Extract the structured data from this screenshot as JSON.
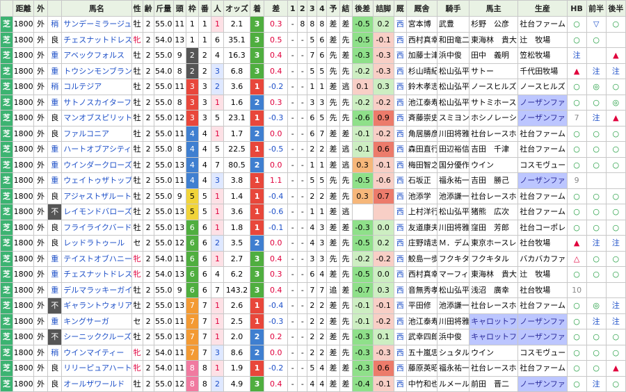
{
  "headers": [
    "距離",
    "外",
    "",
    "馬名",
    "性",
    "齢",
    "斤量",
    "頭",
    "枠",
    "番",
    "人",
    "オッズ",
    "着",
    "差",
    "1",
    "2",
    "3",
    "4",
    "予",
    "結",
    "後差",
    "詰脚",
    "厩",
    "厩舎",
    "騎手",
    "馬主",
    "生産",
    "HB",
    "前半",
    "後半"
  ],
  "surface": "芝",
  "rows": [
    {
      "dist": "1800",
      "io": "外",
      "cond": "稍",
      "name": "サンデーミラージュ",
      "sex": "牡",
      "age": "2",
      "wt": "55.0",
      "n": "11",
      "waku": "1",
      "ban": "1",
      "pop": "1",
      "odds": "2.1",
      "res": "3",
      "diff": "0.3",
      "c1": "-",
      "c2": "8",
      "c3": "8",
      "c4": "8",
      "yo": "差",
      "ke": "差",
      "ato": "-0.5",
      "tsume": "0.2",
      "umaya": "西",
      "kyu": "宮本博",
      "jockey": "武豊",
      "owner": "杉野　公彦",
      "maker": "社台ファーム",
      "hb": "○",
      "zen": "▽",
      "kou": "○"
    },
    {
      "dist": "1800",
      "io": "外",
      "cond": "良",
      "name": "チェスナットドレス",
      "sex": "牝",
      "age": "2",
      "wt": "54.0",
      "n": "13",
      "waku": "1",
      "ban": "1",
      "pop": "6",
      "odds": "35.1",
      "res": "3",
      "diff": "0.5",
      "c1": "-",
      "c2": "-",
      "c3": "5",
      "c4": "6",
      "yo": "差",
      "ke": "先",
      "ato": "-0.5",
      "tsume": "-0.1",
      "umaya": "西",
      "kyu": "西村真幸",
      "jockey": "和田竜二",
      "owner": "東海林　貴大",
      "maker": "辻　牧場",
      "hb": "○",
      "zen": "○",
      "kou": ""
    },
    {
      "dist": "1800",
      "io": "外",
      "cond": "重",
      "name": "アベックフォルス",
      "sex": "牡",
      "age": "2",
      "wt": "55.0",
      "n": "9",
      "waku": "2",
      "ban": "2",
      "pop": "4",
      "odds": "16.3",
      "res": "3",
      "diff": "0.4",
      "c1": "-",
      "c2": "-",
      "c3": "7",
      "c4": "6",
      "yo": "先",
      "ke": "差",
      "ato": "-0.3",
      "tsume": "-0.3",
      "umaya": "西",
      "kyu": "加藤士津",
      "jockey": "浜中俊",
      "owner": "田中　義明",
      "maker": "笠松牧場",
      "hb": "注",
      "zen": "",
      "kou": "▲"
    },
    {
      "dist": "1800",
      "io": "外",
      "cond": "重",
      "name": "トウシンモンブラン",
      "sex": "牡",
      "age": "2",
      "wt": "54.0",
      "n": "8",
      "waku": "2",
      "ban": "2",
      "pop": "3",
      "odds": "6.8",
      "res": "3",
      "diff": "0.4",
      "c1": "-",
      "c2": "-",
      "c3": "5",
      "c4": "5",
      "yo": "先",
      "ke": "先",
      "ato": "-0.2",
      "tsume": "-0.3",
      "umaya": "西",
      "kyu": "杉山晴紀",
      "jockey": "松山弘平",
      "owner": "サトー",
      "maker": "千代田牧場",
      "hb": "▲",
      "zen": "注",
      "kou": "注"
    },
    {
      "dist": "1800",
      "io": "外",
      "cond": "稍",
      "name": "コルテジア",
      "sex": "牡",
      "age": "2",
      "wt": "55.0",
      "n": "11",
      "waku": "3",
      "ban": "3",
      "pop": "2",
      "odds": "3.6",
      "res": "1",
      "diff": "-0.2",
      "c1": "-",
      "c2": "-",
      "c3": "1",
      "c4": "1",
      "yo": "差",
      "ke": "逃",
      "ato": "0.1",
      "tsume": "0.3",
      "umaya": "西",
      "kyu": "鈴木孝志",
      "jockey": "松山弘平",
      "owner": "ノースヒルズ",
      "maker": "ノースヒルズ",
      "hb": "○",
      "zen": "◎",
      "kou": "○"
    },
    {
      "dist": "1800",
      "io": "外",
      "cond": "重",
      "name": "サトノスカイターフ",
      "sex": "牡",
      "age": "2",
      "wt": "55.0",
      "n": "8",
      "waku": "3",
      "ban": "3",
      "pop": "1",
      "odds": "1.6",
      "res": "2",
      "diff": "0.3",
      "c1": "-",
      "c2": "-",
      "c3": "3",
      "c4": "3",
      "yo": "先",
      "ke": "先",
      "ato": "-0.2",
      "tsume": "-0.2",
      "umaya": "西",
      "kyu": "池江泰寿",
      "jockey": "松山弘平",
      "owner": "サトミホース",
      "maker": "ノーザンファ",
      "hb": "○",
      "zen": "○",
      "kou": "◎"
    },
    {
      "dist": "1800",
      "io": "外",
      "cond": "良",
      "name": "マンオブスピリット",
      "sex": "牡",
      "age": "2",
      "wt": "55.0",
      "n": "12",
      "waku": "3",
      "ban": "3",
      "pop": "5",
      "odds": "23.1",
      "res": "1",
      "diff": "-0.3",
      "c1": "-",
      "c2": "-",
      "c3": "6",
      "c4": "5",
      "yo": "先",
      "ke": "先",
      "ato": "-0.6",
      "tsume": "0.9",
      "umaya": "西",
      "kyu": "斉藤崇史",
      "jockey": "スミヨン",
      "owner": "ホシノレーシ",
      "maker": "ノーザンファ",
      "hb": "7",
      "zen": "注",
      "kou": "▲"
    },
    {
      "dist": "1800",
      "io": "外",
      "cond": "良",
      "name": "ファルコニア",
      "sex": "牡",
      "age": "2",
      "wt": "55.0",
      "n": "11",
      "waku": "4",
      "ban": "4",
      "pop": "1",
      "odds": "1.7",
      "res": "2",
      "diff": "0.0",
      "c1": "-",
      "c2": "-",
      "c3": "6",
      "c4": "7",
      "yo": "差",
      "ke": "差",
      "ato": "-0.1",
      "tsume": "-0.2",
      "umaya": "西",
      "kyu": "角居勝彦",
      "jockey": "川田将雅",
      "owner": "社台レースホ",
      "maker": "社台ファーム",
      "hb": "○",
      "zen": "○",
      "kou": "○"
    },
    {
      "dist": "1800",
      "io": "外",
      "cond": "重",
      "name": "ハートオブアシティ",
      "sex": "牡",
      "age": "2",
      "wt": "55.0",
      "n": "8",
      "waku": "4",
      "ban": "4",
      "pop": "5",
      "odds": "22.5",
      "res": "1",
      "diff": "-0.5",
      "c1": "-",
      "c2": "-",
      "c3": "2",
      "c4": "2",
      "yo": "差",
      "ke": "逃",
      "ato": "-0.1",
      "tsume": "0.6",
      "umaya": "西",
      "kyu": "森田直行",
      "jockey": "田辺裕信",
      "owner": "吉田　千津",
      "maker": "社台ファーム",
      "hb": "○",
      "zen": "○",
      "kou": "○"
    },
    {
      "dist": "1800",
      "io": "外",
      "cond": "重",
      "name": "ウインダークローズ",
      "sex": "牡",
      "age": "2",
      "wt": "55.0",
      "n": "13",
      "waku": "4",
      "ban": "4",
      "pop": "7",
      "odds": "80.5",
      "res": "2",
      "diff": "0.0",
      "c1": "-",
      "c2": "-",
      "c3": "1",
      "c4": "1",
      "yo": "差",
      "ke": "逃",
      "ato": "0.3",
      "tsume": "-0.1",
      "umaya": "西",
      "kyu": "梅田智之",
      "jockey": "国分優作",
      "owner": "ウイン",
      "maker": "コスモヴュー",
      "hb": "○",
      "zen": "○",
      "kou": "○"
    },
    {
      "dist": "1800",
      "io": "外",
      "cond": "重",
      "name": "ウェイトゥザトップ",
      "sex": "牡",
      "age": "2",
      "wt": "55.0",
      "n": "11",
      "waku": "4",
      "ban": "4",
      "pop": "3",
      "odds": "3.8",
      "res": "1",
      "diff": "1.1",
      "c1": "-",
      "c2": "-",
      "c3": "5",
      "c4": "5",
      "yo": "先",
      "ke": "先",
      "ato": "-0.5",
      "tsume": "-0.6",
      "umaya": "西",
      "kyu": "石坂正",
      "jockey": "福永祐一",
      "owner": "吉田　勝己",
      "maker": "ノーザンファ",
      "hb": "9",
      "zen": "",
      "kou": ""
    },
    {
      "dist": "1800",
      "io": "外",
      "cond": "良",
      "name": "アジャストザルート",
      "sex": "牡",
      "age": "2",
      "wt": "55.0",
      "n": "9",
      "waku": "5",
      "ban": "5",
      "pop": "1",
      "odds": "1.4",
      "res": "1",
      "diff": "-0.4",
      "c1": "-",
      "c2": "-",
      "c3": "2",
      "c4": "2",
      "yo": "差",
      "ke": "先",
      "ato": "0.3",
      "tsume": "0.7",
      "umaya": "西",
      "kyu": "池添学",
      "jockey": "池添謙一",
      "owner": "社台レースホ",
      "maker": "社台ファーム",
      "hb": "○",
      "zen": "○",
      "kou": "○"
    },
    {
      "dist": "1800",
      "io": "外",
      "cond": "不",
      "name": "レイモンドバローズ",
      "sex": "牡",
      "age": "2",
      "wt": "55.0",
      "n": "13",
      "waku": "5",
      "ban": "5",
      "pop": "1",
      "odds": "3.6",
      "res": "1",
      "diff": "-0.6",
      "c1": "-",
      "c2": "-",
      "c3": "1",
      "c4": "1",
      "yo": "差",
      "ke": "逃",
      "ato": "",
      "tsume": "",
      "umaya": "西",
      "kyu": "上村洋行",
      "jockey": "松山弘平",
      "owner": "猪熊　広次",
      "maker": "社台ファーム",
      "hb": "○",
      "zen": "○",
      "kou": "○"
    },
    {
      "dist": "1800",
      "io": "外",
      "cond": "良",
      "name": "フライライクバード",
      "sex": "牡",
      "age": "2",
      "wt": "55.0",
      "n": "13",
      "waku": "6",
      "ban": "6",
      "pop": "1",
      "odds": "1.8",
      "res": "1",
      "diff": "-0.1",
      "c1": "-",
      "c2": "-",
      "c3": "4",
      "c4": "3",
      "yo": "差",
      "ke": "差",
      "ato": "-0.3",
      "tsume": "0.0",
      "umaya": "西",
      "kyu": "友道康夫",
      "jockey": "川田将雅",
      "owner": "窪田　芳郎",
      "maker": "社台コーポレ",
      "hb": "○",
      "zen": "○",
      "kou": "○"
    },
    {
      "dist": "1800",
      "io": "外",
      "cond": "良",
      "name": "レッドラトゥール",
      "sex": "セ",
      "age": "2",
      "wt": "55.0",
      "n": "12",
      "waku": "6",
      "ban": "6",
      "pop": "2",
      "odds": "3.5",
      "res": "2",
      "diff": "0.0",
      "c1": "-",
      "c2": "-",
      "c3": "4",
      "c4": "3",
      "yo": "差",
      "ke": "先",
      "ato": "-0.5",
      "tsume": "0.2",
      "umaya": "西",
      "kyu": "庄野靖志",
      "jockey": "Ｍ．デム",
      "owner": "東京ホースレ",
      "maker": "社台牧場",
      "hb": "▲",
      "zen": "注",
      "kou": "注"
    },
    {
      "dist": "1800",
      "io": "外",
      "cond": "重",
      "name": "テイストオブハニー",
      "sex": "牝",
      "age": "2",
      "wt": "54.0",
      "n": "11",
      "waku": "6",
      "ban": "6",
      "pop": "1",
      "odds": "2.7",
      "res": "3",
      "diff": "0.4",
      "c1": "-",
      "c2": "-",
      "c3": "3",
      "c4": "3",
      "yo": "先",
      "ke": "先",
      "ato": "-0.2",
      "tsume": "-0.2",
      "umaya": "西",
      "kyu": "鮫島一歩",
      "jockey": "フクキタル",
      "owner": "フクキタル",
      "maker": "バカバカファ",
      "hb": "△",
      "zen": "○",
      "kou": "○"
    },
    {
      "dist": "1800",
      "io": "外",
      "cond": "重",
      "name": "チェスナットドレス",
      "sex": "牝",
      "age": "2",
      "wt": "54.0",
      "n": "13",
      "waku": "6",
      "ban": "6",
      "pop": "4",
      "odds": "6.2",
      "res": "3",
      "diff": "0.3",
      "c1": "-",
      "c2": "-",
      "c3": "6",
      "c4": "4",
      "yo": "差",
      "ke": "先",
      "ato": "-0.5",
      "tsume": "0.0",
      "umaya": "西",
      "kyu": "西村真幸",
      "jockey": "マーフィ",
      "owner": "東海林　貴大",
      "maker": "辻　牧場",
      "hb": "○",
      "zen": "○",
      "kou": "○"
    },
    {
      "dist": "1800",
      "io": "外",
      "cond": "重",
      "name": "デルマラッキーガイ",
      "sex": "牡",
      "age": "2",
      "wt": "55.0",
      "n": "9",
      "waku": "6",
      "ban": "6",
      "pop": "7",
      "odds": "143.2",
      "res": "3",
      "diff": "0.4",
      "c1": "-",
      "c2": "-",
      "c3": "7",
      "c4": "7",
      "yo": "追",
      "ke": "差",
      "ato": "-0.7",
      "tsume": "0.3",
      "umaya": "西",
      "kyu": "音無秀孝",
      "jockey": "松山弘平",
      "owner": "浅沼　廣幸",
      "maker": "社台牧場",
      "hb": "10",
      "zen": "",
      "kou": ""
    },
    {
      "dist": "1800",
      "io": "外",
      "cond": "不",
      "name": "ギャラントウォリア",
      "sex": "牡",
      "age": "2",
      "wt": "55.0",
      "n": "13",
      "waku": "7",
      "ban": "7",
      "pop": "1",
      "odds": "2.6",
      "res": "1",
      "diff": "-0.4",
      "c1": "-",
      "c2": "-",
      "c3": "2",
      "c4": "2",
      "yo": "差",
      "ke": "先",
      "ato": "-0.1",
      "tsume": "-0.1",
      "umaya": "西",
      "kyu": "平田修",
      "jockey": "池添謙一",
      "owner": "社台レースホ",
      "maker": "社台ファーム",
      "hb": "○",
      "zen": "◎",
      "kou": "注"
    },
    {
      "dist": "1800",
      "io": "外",
      "cond": "重",
      "name": "キングサーガ",
      "sex": "セ",
      "age": "2",
      "wt": "55.0",
      "n": "11",
      "waku": "7",
      "ban": "7",
      "pop": "1",
      "odds": "2.5",
      "res": "1",
      "diff": "-0.3",
      "c1": "-",
      "c2": "-",
      "c3": "2",
      "c4": "2",
      "yo": "差",
      "ke": "先",
      "ato": "-0.1",
      "tsume": "-0.2",
      "umaya": "西",
      "kyu": "池江泰寿",
      "jockey": "川田将雅",
      "owner": "キャロットフ",
      "maker": "ノーザンファ",
      "hb": "○",
      "zen": "注",
      "kou": "注"
    },
    {
      "dist": "1800",
      "io": "外",
      "cond": "不",
      "name": "シーニッククルーズ",
      "sex": "牡",
      "age": "2",
      "wt": "55.0",
      "n": "13",
      "waku": "7",
      "ban": "7",
      "pop": "1",
      "odds": "2.0",
      "res": "2",
      "diff": "0.2",
      "c1": "-",
      "c2": "-",
      "c3": "2",
      "c4": "2",
      "yo": "差",
      "ke": "先",
      "ato": "-0.3",
      "tsume": "0.1",
      "umaya": "西",
      "kyu": "武幸四郎",
      "jockey": "浜中俊",
      "owner": "キャロットフ",
      "maker": "ノーザンファ",
      "hb": "○",
      "zen": "○",
      "kou": "○"
    },
    {
      "dist": "1800",
      "io": "外",
      "cond": "稍",
      "name": "ウインマイティー",
      "sex": "牝",
      "age": "2",
      "wt": "54.0",
      "n": "11",
      "waku": "7",
      "ban": "7",
      "pop": "3",
      "odds": "8.6",
      "res": "2",
      "diff": "0.0",
      "c1": "-",
      "c2": "-",
      "c3": "2",
      "c4": "2",
      "yo": "差",
      "ke": "先",
      "ato": "-0.3",
      "tsume": "-0.3",
      "umaya": "西",
      "kyu": "五十嵐忠",
      "jockey": "シュタル",
      "owner": "ウイン",
      "maker": "コスモヴュー",
      "hb": "○",
      "zen": "○",
      "kou": "○"
    },
    {
      "dist": "1800",
      "io": "外",
      "cond": "良",
      "name": "リリーピュアハート",
      "sex": "牝",
      "age": "2",
      "wt": "54.0",
      "n": "11",
      "waku": "8",
      "ban": "8",
      "pop": "1",
      "odds": "1.9",
      "res": "1",
      "diff": "-0.2",
      "c1": "-",
      "c2": "-",
      "c3": "5",
      "c4": "4",
      "yo": "差",
      "ke": "差",
      "ato": "-0.3",
      "tsume": "0.6",
      "umaya": "西",
      "kyu": "藤原英昭",
      "jockey": "福永祐一",
      "owner": "社台レースホ",
      "maker": "社台ファーム",
      "hb": "○",
      "zen": "○",
      "kou": "▲"
    },
    {
      "dist": "1800",
      "io": "外",
      "cond": "良",
      "name": "オールザワールド",
      "sex": "牡",
      "age": "2",
      "wt": "55.0",
      "n": "12",
      "waku": "8",
      "ban": "8",
      "pop": "2",
      "odds": "4.9",
      "res": "3",
      "diff": "0.4",
      "c1": "-",
      "c2": "-",
      "c3": "4",
      "c4": "4",
      "yo": "差",
      "ke": "差",
      "ato": "-0.4",
      "tsume": "-0.1",
      "umaya": "西",
      "kyu": "中竹和也",
      "jockey": "ルメール",
      "owner": "前田　晋二",
      "maker": "ノーザンファ",
      "hb": "○",
      "zen": "注",
      "kou": "○"
    }
  ]
}
